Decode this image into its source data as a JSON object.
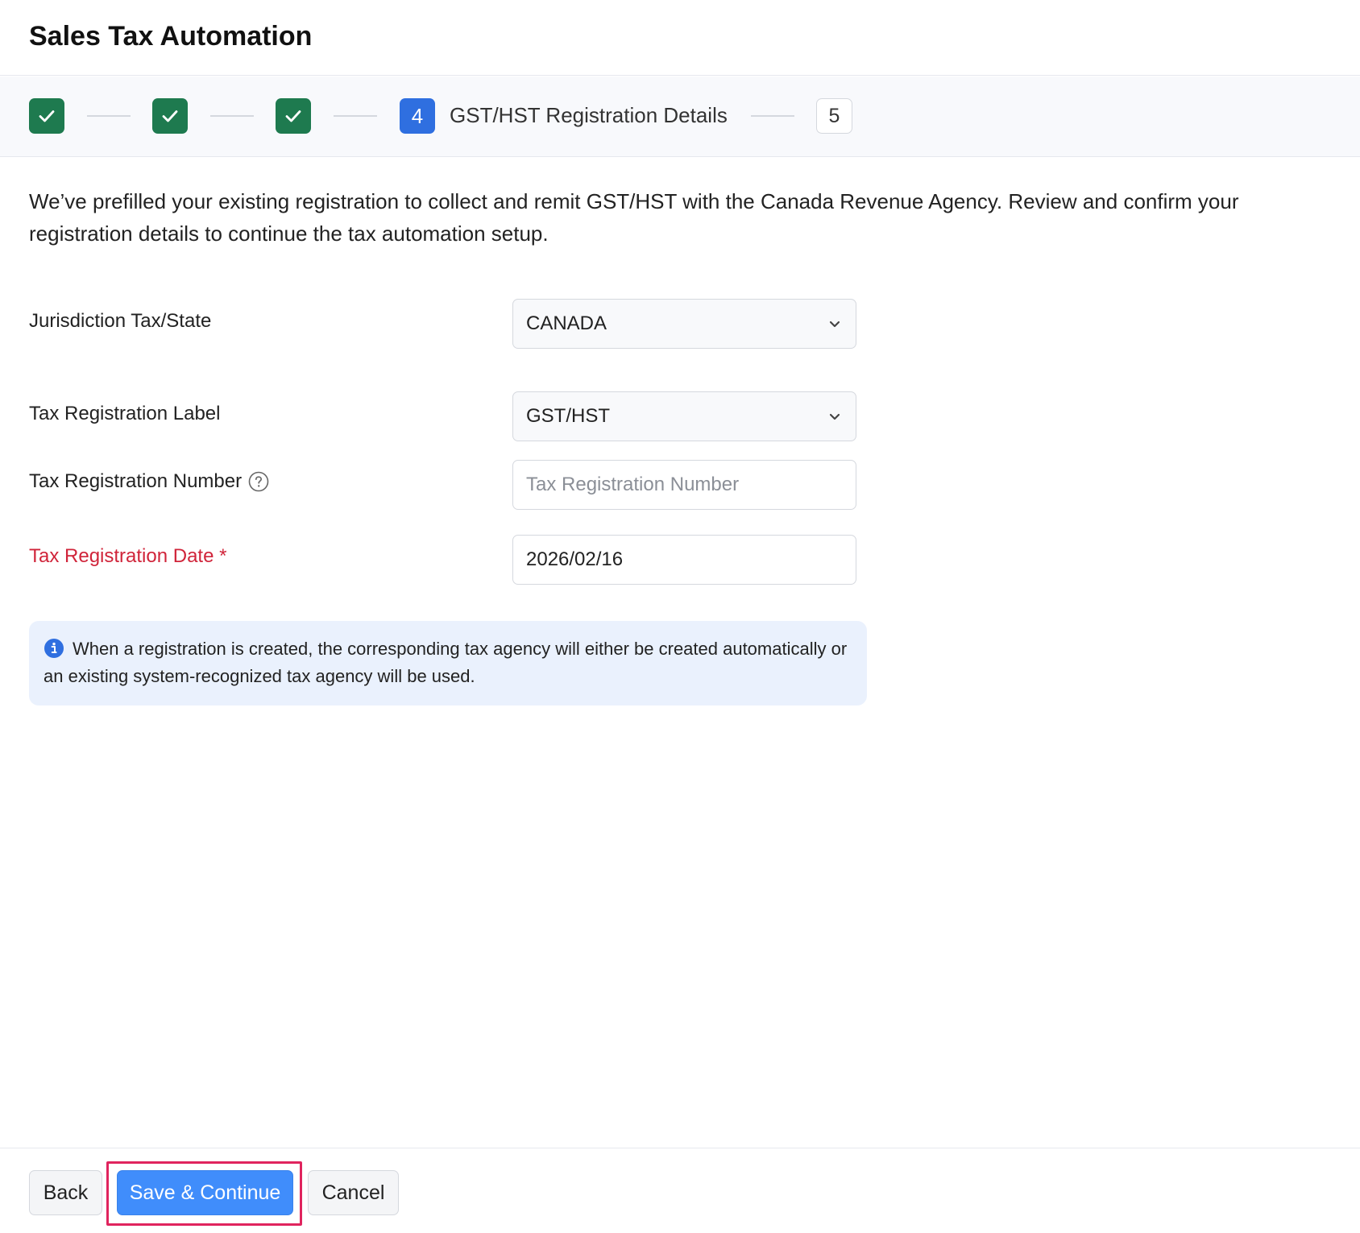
{
  "header": {
    "title": "Sales Tax Automation"
  },
  "stepper": {
    "active_step_number": "4",
    "active_step_label": "GST/HST Registration Details",
    "next_step_number": "5",
    "completed_icon": "check-icon"
  },
  "intro_text": "We’ve prefilled your existing registration to collect and remit GST/HST with the Canada Revenue Agency. Review and confirm your registration details to continue the tax automation setup.",
  "form": {
    "jurisdiction": {
      "label": "Jurisdiction Tax/State",
      "value": "CANADA"
    },
    "reg_label": {
      "label": "Tax Registration Label",
      "value": "GST/HST"
    },
    "reg_number": {
      "label": "Tax Registration Number",
      "placeholder": "Tax Registration Number",
      "value": ""
    },
    "reg_date": {
      "label": "Tax Registration Date *",
      "value": "2026/02/16"
    }
  },
  "info": {
    "text": "When a registration is created, the corresponding tax agency will either be created automatically or an existing system-recognized tax agency will be used."
  },
  "footer": {
    "back_label": "Back",
    "save_label": "Save & Continue",
    "cancel_label": "Cancel"
  },
  "colors": {
    "completed": "#1e7a4f",
    "active": "#2f6fe0",
    "primary_button": "#408dfb",
    "required": "#d0243a",
    "highlight": "#e0245e"
  }
}
